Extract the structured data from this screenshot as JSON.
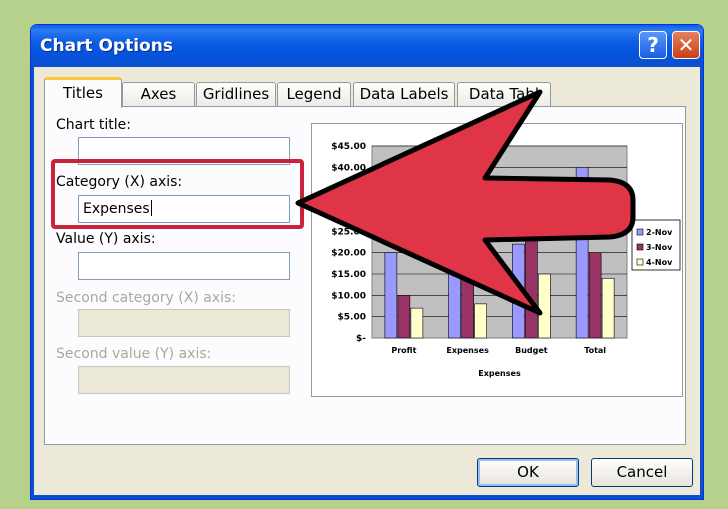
{
  "dialog": {
    "title": "Chart Options",
    "help_label": "?",
    "close_label": "✕"
  },
  "tabs": [
    "Titles",
    "Axes",
    "Gridlines",
    "Legend",
    "Data Labels",
    "Data Tabl"
  ],
  "fields": {
    "chart_title": {
      "label": "Chart title:",
      "value": ""
    },
    "category_x": {
      "label": "Category (X) axis:",
      "value": "Expenses"
    },
    "value_y": {
      "label": "Value (Y) axis:",
      "value": ""
    },
    "second_category_x": {
      "label": "Second category (X) axis:",
      "value": ""
    },
    "second_value_y": {
      "label": "Second value (Y) axis:",
      "value": ""
    }
  },
  "buttons": {
    "ok": "OK",
    "cancel": "Cancel"
  },
  "colors": {
    "highlight": "#c8233a",
    "arrow": "#e03447",
    "plot_bg": "#c0c0c0"
  },
  "chart_data": {
    "type": "bar",
    "categories": [
      "Profit",
      "Expenses",
      "Budget",
      "Total"
    ],
    "series": [
      {
        "name": "2-Nov",
        "color": "#9999ff",
        "values": [
          20,
          22,
          22,
          40
        ]
      },
      {
        "name": "3-Nov",
        "color": "#993366",
        "values": [
          10,
          14,
          23,
          20
        ]
      },
      {
        "name": "4-Nov",
        "color": "#ffffcc",
        "values": [
          7,
          8,
          15,
          14
        ]
      }
    ],
    "xlabel": "Expenses",
    "ylabel": "",
    "ylim": [
      0,
      45
    ],
    "y_ticks": [
      0,
      5,
      10,
      15,
      20,
      25,
      30,
      35,
      40,
      45
    ],
    "y_tick_labels": [
      "$-",
      "$5.00",
      "$10.00",
      "$15.00",
      "$20.00",
      "$25.00",
      "$30.00",
      "$35.00",
      "$40.00",
      "$45.00"
    ],
    "grid": true,
    "legend": "right"
  }
}
